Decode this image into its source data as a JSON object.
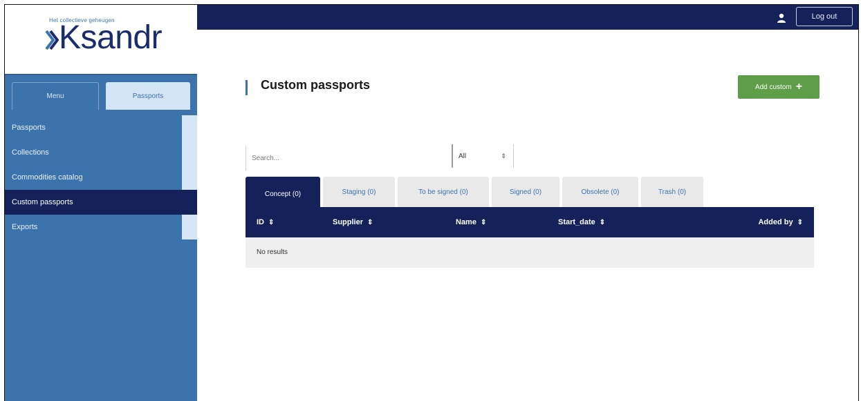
{
  "header": {
    "logout_label": "Log out"
  },
  "logo": {
    "tagline": "Het collectieve geheugen",
    "wordmark": "Ksandr"
  },
  "sidebar": {
    "tabs": [
      {
        "label": "Menu"
      },
      {
        "label": "Passports"
      }
    ],
    "items": [
      {
        "label": "Passports"
      },
      {
        "label": "Collections"
      },
      {
        "label": "Commodities catalog"
      },
      {
        "label": "Custom passports"
      },
      {
        "label": "Exports"
      }
    ]
  },
  "main": {
    "title": "Custom passports",
    "add_label": "Add custom",
    "add_icon": "plus-icon",
    "search_placeholder": "Search...",
    "filter_value": "All",
    "tabs": [
      {
        "label": "Concept (0)"
      },
      {
        "label": "Staging (0)"
      },
      {
        "label": "To be signed (0)"
      },
      {
        "label": "Signed (0)"
      },
      {
        "label": "Obsolete (0)"
      },
      {
        "label": "Trash (0)"
      }
    ],
    "table": {
      "columns": [
        "ID",
        "Supplier",
        "Name",
        "Start_date",
        "Added by"
      ],
      "sort_icon": "⇕",
      "empty_text": "No results"
    }
  },
  "colors": {
    "navy": "#15225a",
    "sidebar_blue": "#3d73ad",
    "green": "#5e9e48"
  }
}
